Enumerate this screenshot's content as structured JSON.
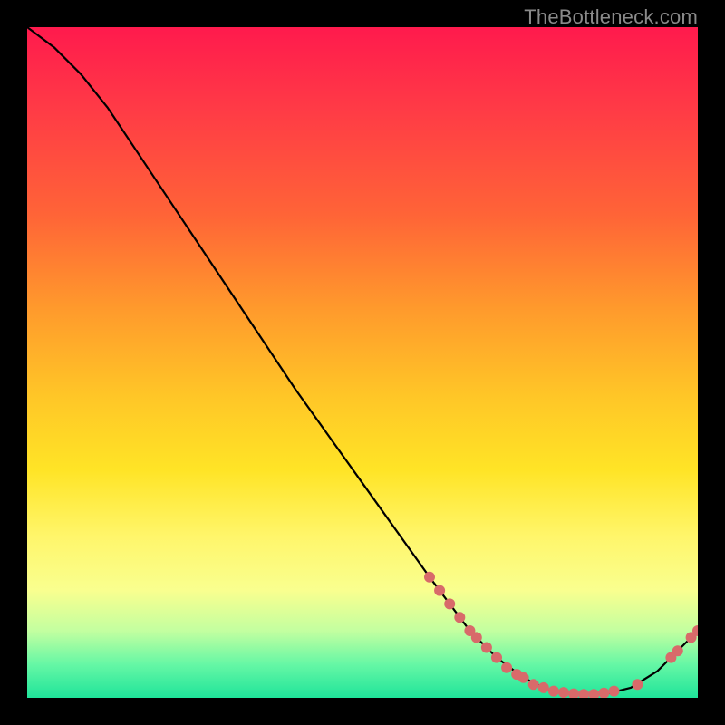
{
  "watermark": "TheBottleneck.com",
  "chart_data": {
    "type": "line",
    "title": "",
    "xlabel": "",
    "ylabel": "",
    "xlim": [
      0,
      100
    ],
    "ylim": [
      0,
      100
    ],
    "series": [
      {
        "name": "curve",
        "x": [
          0,
          4,
          8,
          12,
          16,
          22,
          30,
          40,
          50,
          60,
          66,
          70,
          74,
          78,
          82,
          86,
          90,
          94,
          100
        ],
        "y": [
          100,
          97,
          93,
          88,
          82,
          73,
          61,
          46,
          32,
          18,
          10,
          6,
          3,
          1,
          0.5,
          0.5,
          1.5,
          4,
          10
        ]
      }
    ],
    "markers": [
      {
        "x": 60.0,
        "y": 18.0
      },
      {
        "x": 61.5,
        "y": 16.0
      },
      {
        "x": 63.0,
        "y": 14.0
      },
      {
        "x": 64.5,
        "y": 12.0
      },
      {
        "x": 66.0,
        "y": 10.0
      },
      {
        "x": 67.0,
        "y": 9.0
      },
      {
        "x": 68.5,
        "y": 7.5
      },
      {
        "x": 70.0,
        "y": 6.0
      },
      {
        "x": 71.5,
        "y": 4.5
      },
      {
        "x": 73.0,
        "y": 3.5
      },
      {
        "x": 74.0,
        "y": 3.0
      },
      {
        "x": 75.5,
        "y": 2.0
      },
      {
        "x": 77.0,
        "y": 1.5
      },
      {
        "x": 78.5,
        "y": 1.0
      },
      {
        "x": 80.0,
        "y": 0.8
      },
      {
        "x": 81.5,
        "y": 0.6
      },
      {
        "x": 83.0,
        "y": 0.5
      },
      {
        "x": 84.5,
        "y": 0.5
      },
      {
        "x": 86.0,
        "y": 0.7
      },
      {
        "x": 87.5,
        "y": 1.0
      },
      {
        "x": 91.0,
        "y": 2.0
      },
      {
        "x": 96.0,
        "y": 6.0
      },
      {
        "x": 97.0,
        "y": 7.0
      },
      {
        "x": 99.0,
        "y": 9.0
      },
      {
        "x": 100.0,
        "y": 10.0
      }
    ],
    "colors": {
      "curve": "#000000",
      "marker": "#d86a6a",
      "gradient_top": "#ff1a4d",
      "gradient_mid": "#ffe426",
      "gradient_bottom": "#1fe49a"
    }
  }
}
